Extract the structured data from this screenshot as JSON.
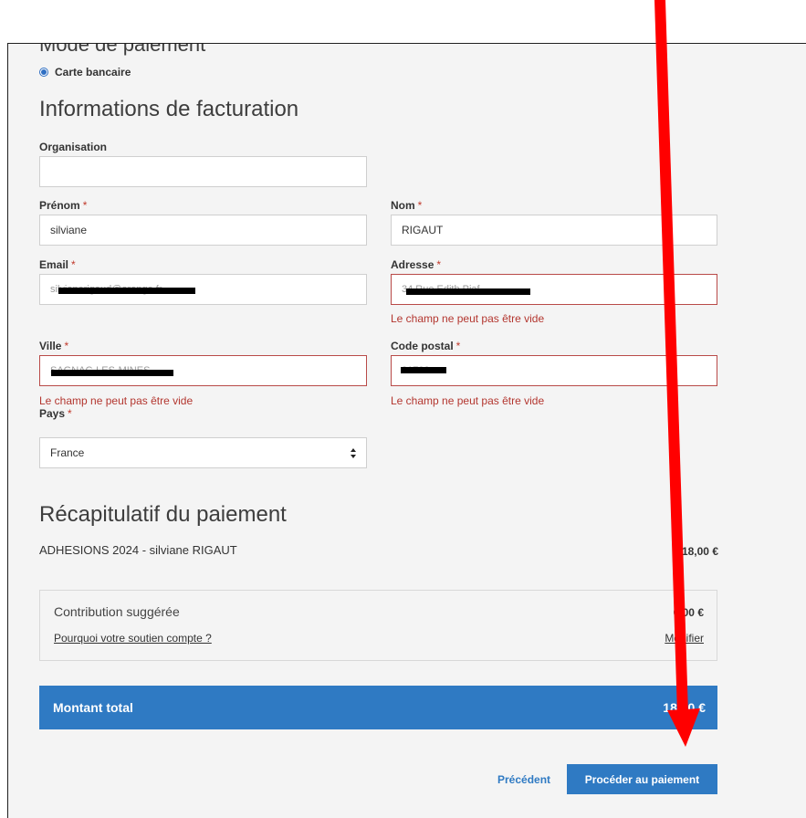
{
  "payment_mode": {
    "heading": "Mode de paiement",
    "option_label": "Carte bancaire"
  },
  "billing": {
    "heading": "Informations de facturation",
    "required_marker": "*",
    "organisation": {
      "label": "Organisation",
      "value": ""
    },
    "prenom": {
      "label": "Prénom",
      "value": "silviane"
    },
    "nom": {
      "label": "Nom",
      "value": "RIGAUT"
    },
    "email": {
      "label": "Email",
      "value": "silvianerigaud@orange.fr"
    },
    "adresse": {
      "label": "Adresse",
      "value": "34 Rue Edith Piaf",
      "error": "Le champ ne peut pas être vide"
    },
    "ville": {
      "label": "Ville",
      "value": "SAGNAC-LES-MINES",
      "error": "Le champ ne peut pas être vide"
    },
    "code_postal": {
      "label": "Code postal",
      "value": "31700",
      "error": "Le champ ne peut pas être vide"
    },
    "pays": {
      "label": "Pays",
      "value": "France"
    }
  },
  "summary": {
    "heading": "Récapitulatif du paiement",
    "line_item": "ADHESIONS 2024 - silviane RIGAUT",
    "line_price": "18,00 €",
    "contribution_label": "Contribution suggérée",
    "contribution_price": "0,00 €",
    "contribution_link": "Pourquoi votre soutien compte ?",
    "modify_link": "Modifier",
    "total_label": "Montant total",
    "total_value": "18,00 €"
  },
  "actions": {
    "previous": "Précédent",
    "pay": "Procéder au paiement"
  },
  "colors": {
    "primary": "#2f7ac3",
    "error": "#b3362f",
    "annotation_arrow": "#ff0000"
  }
}
